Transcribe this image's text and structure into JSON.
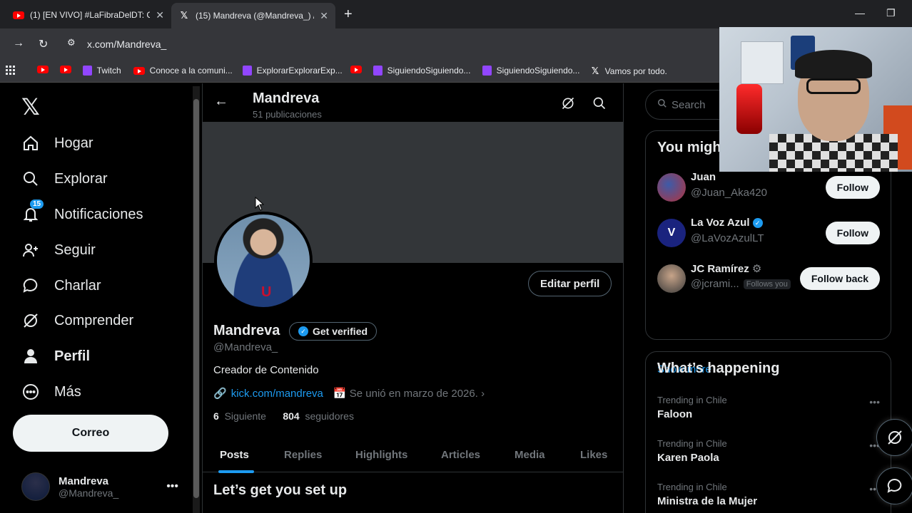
{
  "browser": {
    "tabs": [
      {
        "title": "(1) [EN VIVO] #LaFibraDelDT: C",
        "favicon": "youtube-icon"
      },
      {
        "title": "(15) Mandreva (@Mandreva_) /",
        "favicon": "x-icon"
      }
    ],
    "url": "x.com/Mandreva_",
    "bookmarks": [
      {
        "label": "",
        "icon": "youtube-icon"
      },
      {
        "label": "",
        "icon": "youtube-icon"
      },
      {
        "label": "Twitch",
        "icon": "twitch-icon"
      },
      {
        "label": "Conoce a la comuni...",
        "icon": "youtube-icon"
      },
      {
        "label": "ExplorarExplorarExp...",
        "icon": "twitch-icon"
      },
      {
        "label": "",
        "icon": "youtube-icon"
      },
      {
        "label": "SiguiendoSiguiendo...",
        "icon": "twitch-icon"
      },
      {
        "label": "SiguiendoSiguiendo...",
        "icon": "twitch-icon"
      },
      {
        "label": "Vamos por todo.",
        "icon": "x-icon"
      }
    ]
  },
  "nav": {
    "items": [
      {
        "label": "Hogar",
        "icon": "home-icon"
      },
      {
        "label": "Explorar",
        "icon": "search-icon"
      },
      {
        "label": "Notificaciones",
        "icon": "bell-icon",
        "badge": "15"
      },
      {
        "label": "Seguir",
        "icon": "add-user-icon"
      },
      {
        "label": "Charlar",
        "icon": "chat-icon"
      },
      {
        "label": "Comprender",
        "icon": "grok-icon"
      },
      {
        "label": "Perfil",
        "icon": "person-icon"
      },
      {
        "label": "Más",
        "icon": "more-circle-icon"
      }
    ],
    "post_button": "Correo",
    "account": {
      "name": "Mandreva",
      "handle": "@Mandreva_"
    }
  },
  "profile": {
    "header_name": "Mandreva",
    "post_count": "51 publicaciones",
    "name": "Mandreva",
    "get_verified": "Get verified",
    "handle": "@Mandreva_",
    "edit_button": "Editar perfil",
    "bio": "Creador de Contenido",
    "link": "kick.com/mandreva",
    "joined": "Se unió en marzo de 2026.",
    "following_count": "6",
    "following_label": "Siguiente",
    "followers_count": "804",
    "followers_label": "seguidores",
    "tabs": [
      "Posts",
      "Replies",
      "Highlights",
      "Articles",
      "Media",
      "Likes"
    ],
    "active_tab": "Posts",
    "setup_title": "Let’s get you set up"
  },
  "sidebar": {
    "search_placeholder": "Search",
    "who_to_follow_title": "You migh",
    "suggestions": [
      {
        "name": "Juan",
        "handle": "@Juan_Aka420",
        "button": "Follow",
        "verified": false
      },
      {
        "name": "La Voz Azul",
        "handle": "@LaVozAzulLT",
        "button": "Follow",
        "verified": true
      },
      {
        "name": "JC Ramírez",
        "handle": "@jcrami...",
        "button": "Follow back",
        "follows_you": "Follows you"
      }
    ],
    "show_more": "Show more",
    "trends_title": "What’s happening",
    "trends": [
      {
        "context": "Trending in Chile",
        "title": "Faloon"
      },
      {
        "context": "Trending in Chile",
        "title": "Karen Paola"
      },
      {
        "context": "Trending in Chile",
        "title": "Ministra de la Mujer"
      }
    ]
  },
  "colors": {
    "accent": "#1d9bf0",
    "background": "#000000",
    "banner": "#333639"
  }
}
